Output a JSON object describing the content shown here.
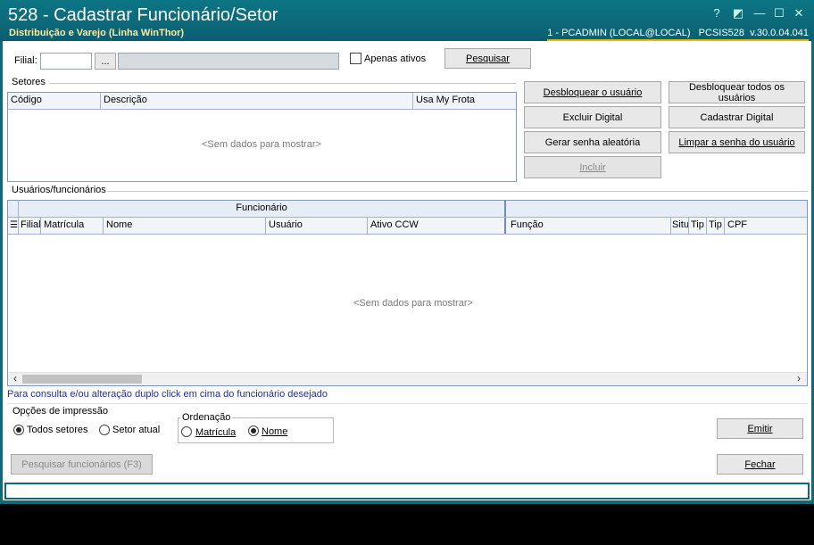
{
  "window": {
    "title": "528 - Cadastrar Funcionário/Setor",
    "subtitle": "Distribuição e Varejo (Linha WinThor)",
    "status": "1 - PCADMIN (LOCAL@LOCAL)   PCSIS528  v.30.0.04.041",
    "controls": {
      "help": "?",
      "restore": "◩",
      "minimize": "—",
      "maximize": "☐",
      "close": "✕"
    }
  },
  "filter": {
    "filial_label": "Filial:",
    "filial_value": "",
    "browse_label": "...",
    "filial_name": "",
    "active_only_label": "Apenas ativos",
    "search_label": "Pesquisar"
  },
  "setores": {
    "section_label": "Setores",
    "columns": [
      "Código",
      "Descrição",
      "Usa My Frota"
    ],
    "empty_text": "<Sem dados para mostrar>"
  },
  "actions": {
    "unlock_user": "Desbloquear o usuário",
    "unlock_all": "Desbloquear todos os usuários",
    "delete_digital": "Excluir Digital",
    "register_digital": "Cadastrar Digital",
    "random_password": "Gerar senha aleatória",
    "clear_password": "Limpar a senha do usuário",
    "include": "Incluir"
  },
  "usuarios": {
    "section_label": "Usuários/funcionários",
    "band_label": "Funcionário",
    "columns": [
      "Filial",
      "Matrícula",
      "Nome",
      "Usuário",
      "Ativo CCW",
      "Função",
      "Situ",
      "Tip",
      "Tip",
      "CPF"
    ],
    "empty_text": "<Sem dados para mostrar>",
    "hint": "Para consulta e/ou alteração duplo click em cima do funcionário desejado"
  },
  "print_options": {
    "label": "Opções de impressão",
    "all_sectors": "Todos setores",
    "current_sector": "Setor atual",
    "ordering_label": "Ordenação",
    "by_registration": "Matrícula",
    "by_name": "Nome"
  },
  "footer": {
    "search_employees": "Pesquisar funcionários (F3)",
    "emit": "Emitir",
    "close": "Fechar"
  }
}
